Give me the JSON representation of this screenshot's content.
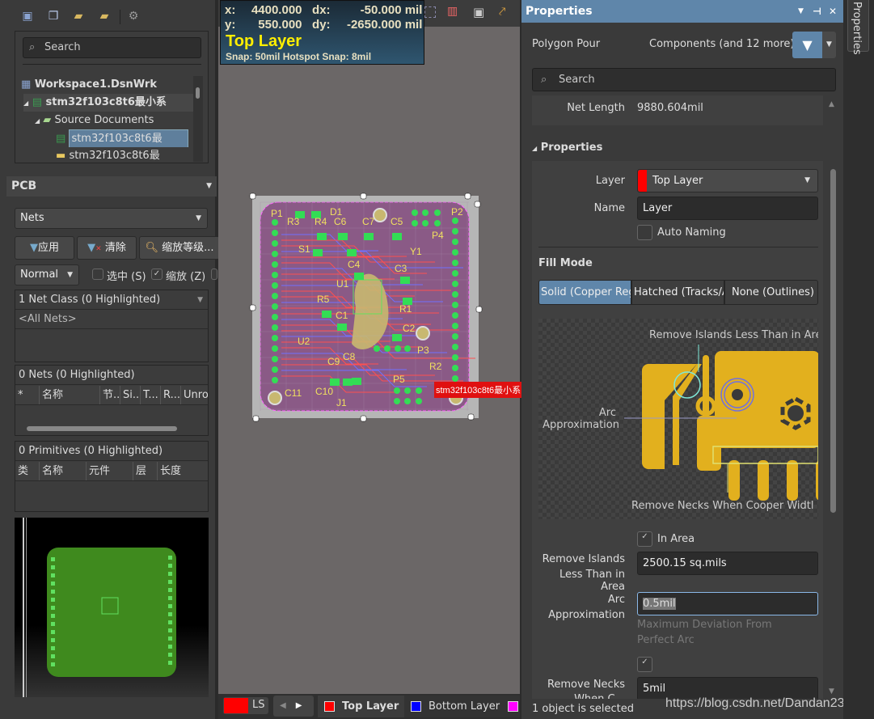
{
  "toolbar_icons": [
    "save-icon",
    "copy-icon",
    "open-folder-search-icon",
    "folder-settings-icon",
    "gear-icon"
  ],
  "projects": {
    "search_placeholder": "Search",
    "tree": [
      {
        "label": "Workspace1.DsnWrk",
        "icon": "workspace-icon",
        "bold": true
      },
      {
        "label": "stm32f103c8t6最小系",
        "icon": "pcb-project-icon",
        "bold": true
      },
      {
        "label": "Source Documents",
        "icon": "folder-icon"
      },
      {
        "label": "stm32f103c8t6最",
        "icon": "pcb-doc-icon",
        "selected": true
      },
      {
        "label": "stm32f103c8t6最",
        "icon": "schematic-doc-icon"
      }
    ]
  },
  "pcb_panel": {
    "title": "PCB",
    "mode": "Nets",
    "buttons": {
      "apply": "应用",
      "clear": "清除",
      "zoom": "缩放等级..."
    },
    "highlight_mode": "Normal",
    "checkboxes": [
      {
        "label": "选中 (S)",
        "checked": false
      },
      {
        "label": "缩放 (Z)",
        "checked": true
      }
    ],
    "net_class": {
      "header": "1 Net Class (0 Highlighted)",
      "rows": [
        "<All Nets>"
      ]
    },
    "nets": {
      "header": "0 Nets (0 Highlighted)",
      "columns": [
        "*",
        "名称",
        "节..",
        "Si...",
        "T...",
        "R...",
        "Unro"
      ]
    },
    "primitives": {
      "header": "0 Primitives (0 Highlighted)",
      "columns": [
        "类",
        "名称",
        "元件",
        "层",
        "长度"
      ]
    }
  },
  "hud": {
    "x_label": "x:",
    "x": "4400.000",
    "dx_label": "dx:",
    "dx": "-50.000",
    "y_label": "y:",
    "y": "550.000",
    "dy_label": "dy:",
    "dy": "-2650.000",
    "unit": "mil",
    "layer": "Top Layer",
    "snap": "Snap: 50mil Hotspot Snap: 8mil"
  },
  "board": {
    "designators": [
      "P1",
      "R3",
      "D1",
      "R4",
      "C6",
      "C7",
      "C5",
      "P2",
      "P4",
      "S1",
      "Y1",
      "C4",
      "C3",
      "U1",
      "R5",
      "R1",
      "C1",
      "C2",
      "P3",
      "U2",
      "C8",
      "C9",
      "R2",
      "P5",
      "C11",
      "C10",
      "J1"
    ],
    "component_tag": "stm32f103c8t6最小系"
  },
  "layer_bar": {
    "current_label": "LS",
    "current_color": "#ff0000",
    "tabs": [
      {
        "label": "Top Layer",
        "color": "#ff0000",
        "active": true
      },
      {
        "label": "Bottom Layer",
        "color": "#0000ff"
      },
      {
        "label": "",
        "color": "#ff00ff"
      }
    ]
  },
  "properties": {
    "title": "Properties",
    "object_type": "Polygon Pour",
    "filter": "Components (and 12 more)",
    "search_placeholder": "Search",
    "net_length_label": "Net Length",
    "net_length": "9880.604mil",
    "section": "Properties",
    "layer_label": "Layer",
    "layer": "Top Layer",
    "layer_color": "#ff0000",
    "name_label": "Name",
    "name": "Layer",
    "auto_naming": "Auto Naming",
    "auto_naming_checked": false,
    "fill_mode_label": "Fill Mode",
    "fill_modes": [
      "Solid (Copper Regi",
      "Hatched (Tracks/A",
      "None (Outlines)"
    ],
    "fill_mode_selected": 0,
    "diagram": {
      "islands": "Remove Islands Less Than in Are",
      "arc": "Arc",
      "arc2": "Approximation",
      "necks": "Remove Necks When Cooper Widtl"
    },
    "in_area": "In Area",
    "in_area_checked": true,
    "islands_label1": "Remove Islands",
    "islands_label2": "Less Than in Area",
    "islands_value": "2500.15 sq.mils",
    "arc_label1": "Arc",
    "arc_label2": "Approximation",
    "arc_value": "0.5mil",
    "arc_hint": "Maximum Deviation From Perfect Arc",
    "necks_checked": true,
    "necks_label1": "Remove Necks",
    "necks_label2": "When C...",
    "necks_value": "5mil",
    "status": "1 object is selected",
    "side_tab": "Properties"
  },
  "watermark": "https://blog.csdn.net/Dandan23___",
  "colors": {
    "accent": "#5f86aa",
    "board": "#8a5a86",
    "copper": "#e0b020",
    "pad": "#33dd55",
    "silk": "#f0e060"
  }
}
